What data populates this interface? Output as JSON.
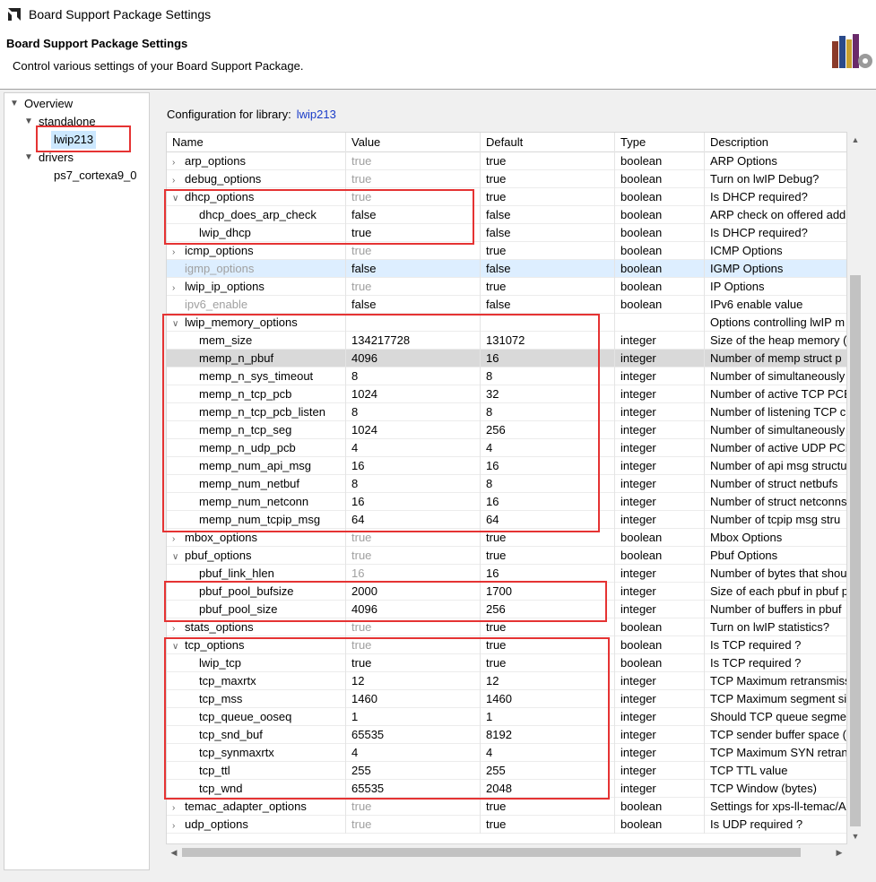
{
  "window": {
    "title": "Board Support Package Settings"
  },
  "header": {
    "title": "Board Support Package Settings",
    "subtitle": "Control various settings of your Board Support Package."
  },
  "tree": {
    "overview": "Overview",
    "standalone": "standalone",
    "lwip": "lwip213",
    "drivers": "drivers",
    "driver_item": "ps7_cortexa9_0"
  },
  "config": {
    "label": "Configuration for library:",
    "library": "lwip213"
  },
  "columns": [
    "Name",
    "Value",
    "Default",
    "Type",
    "Description"
  ],
  "rows": [
    {
      "name": "arp_options",
      "value": "true",
      "default": "true",
      "type": "boolean",
      "desc": "ARP Options"
    },
    {
      "name": "debug_options",
      "value": "true",
      "default": "true",
      "type": "boolean",
      "desc": "Turn on lwIP Debug?"
    },
    {
      "name": "dhcp_options",
      "value": "true",
      "default": "true",
      "type": "boolean",
      "desc": "Is DHCP required?"
    },
    {
      "name": "dhcp_does_arp_check",
      "value": "false",
      "default": "false",
      "type": "boolean",
      "desc": "ARP check on offered add"
    },
    {
      "name": "lwip_dhcp",
      "value": "true",
      "default": "false",
      "type": "boolean",
      "desc": "Is DHCP required?"
    },
    {
      "name": "icmp_options",
      "value": "true",
      "default": "true",
      "type": "boolean",
      "desc": "ICMP Options"
    },
    {
      "name": "igmp_options",
      "value": "false",
      "default": "false",
      "type": "boolean",
      "desc": "IGMP Options"
    },
    {
      "name": "lwip_ip_options",
      "value": "true",
      "default": "true",
      "type": "boolean",
      "desc": "IP Options"
    },
    {
      "name": "ipv6_enable",
      "value": "false",
      "default": "false",
      "type": "boolean",
      "desc": "IPv6 enable value"
    },
    {
      "name": "lwip_memory_options",
      "value": "",
      "default": "",
      "type": "",
      "desc": "Options controlling lwIP m"
    },
    {
      "name": "mem_size",
      "value": "134217728",
      "default": "131072",
      "type": "integer",
      "desc": "Size of the heap memory ("
    },
    {
      "name": "memp_n_pbuf",
      "value": "4096",
      "default": "16",
      "type": "integer",
      "desc": "Number of memp struct p"
    },
    {
      "name": "memp_n_sys_timeout",
      "value": "8",
      "default": "8",
      "type": "integer",
      "desc": "Number of simultaneously"
    },
    {
      "name": "memp_n_tcp_pcb",
      "value": "1024",
      "default": "32",
      "type": "integer",
      "desc": "Number of active TCP PCB"
    },
    {
      "name": "memp_n_tcp_pcb_listen",
      "value": "8",
      "default": "8",
      "type": "integer",
      "desc": "Number of listening TCP c"
    },
    {
      "name": "memp_n_tcp_seg",
      "value": "1024",
      "default": "256",
      "type": "integer",
      "desc": "Number of simultaneously"
    },
    {
      "name": "memp_n_udp_pcb",
      "value": "4",
      "default": "4",
      "type": "integer",
      "desc": "Number of active UDP PCB"
    },
    {
      "name": "memp_num_api_msg",
      "value": "16",
      "default": "16",
      "type": "integer",
      "desc": "Number of api msg structu"
    },
    {
      "name": "memp_num_netbuf",
      "value": "8",
      "default": "8",
      "type": "integer",
      "desc": "Number of struct netbufs"
    },
    {
      "name": "memp_num_netconn",
      "value": "16",
      "default": "16",
      "type": "integer",
      "desc": "Number of struct netconns"
    },
    {
      "name": "memp_num_tcpip_msg",
      "value": "64",
      "default": "64",
      "type": "integer",
      "desc": "Number of tcpip msg stru"
    },
    {
      "name": "mbox_options",
      "value": "true",
      "default": "true",
      "type": "boolean",
      "desc": "Mbox Options"
    },
    {
      "name": "pbuf_options",
      "value": "true",
      "default": "true",
      "type": "boolean",
      "desc": "Pbuf Options"
    },
    {
      "name": "pbuf_link_hlen",
      "value": "16",
      "default": "16",
      "type": "integer",
      "desc": "Number of bytes that shou"
    },
    {
      "name": "pbuf_pool_bufsize",
      "value": "2000",
      "default": "1700",
      "type": "integer",
      "desc": "Size of each pbuf in pbuf p"
    },
    {
      "name": "pbuf_pool_size",
      "value": "4096",
      "default": "256",
      "type": "integer",
      "desc": "Number of buffers in pbuf"
    },
    {
      "name": "stats_options",
      "value": "true",
      "default": "true",
      "type": "boolean",
      "desc": "Turn on lwIP statistics?"
    },
    {
      "name": "tcp_options",
      "value": "true",
      "default": "true",
      "type": "boolean",
      "desc": "Is TCP required ?"
    },
    {
      "name": "lwip_tcp",
      "value": "true",
      "default": "true",
      "type": "boolean",
      "desc": "Is TCP required ?"
    },
    {
      "name": "tcp_maxrtx",
      "value": "12",
      "default": "12",
      "type": "integer",
      "desc": "TCP Maximum retransmiss"
    },
    {
      "name": "tcp_mss",
      "value": "1460",
      "default": "1460",
      "type": "integer",
      "desc": "TCP Maximum segment siz"
    },
    {
      "name": "tcp_queue_ooseq",
      "value": "1",
      "default": "1",
      "type": "integer",
      "desc": "Should TCP queue segmer"
    },
    {
      "name": "tcp_snd_buf",
      "value": "65535",
      "default": "8192",
      "type": "integer",
      "desc": "TCP sender buffer space (l"
    },
    {
      "name": "tcp_synmaxrtx",
      "value": "4",
      "default": "4",
      "type": "integer",
      "desc": "TCP Maximum SYN retrans"
    },
    {
      "name": "tcp_ttl",
      "value": "255",
      "default": "255",
      "type": "integer",
      "desc": "TCP TTL value"
    },
    {
      "name": "tcp_wnd",
      "value": "65535",
      "default": "2048",
      "type": "integer",
      "desc": "TCP Window (bytes)"
    },
    {
      "name": "temac_adapter_options",
      "value": "true",
      "default": "true",
      "type": "boolean",
      "desc": "Settings for xps-ll-temac/A"
    },
    {
      "name": "udp_options",
      "value": "true",
      "default": "true",
      "type": "boolean",
      "desc": "Is UDP required ?"
    }
  ],
  "colors": {
    "highlight_box": "#e53333",
    "link": "#1a3cc8",
    "selected_row": "#d9d9d9",
    "hover_row": "#ddeeff"
  }
}
